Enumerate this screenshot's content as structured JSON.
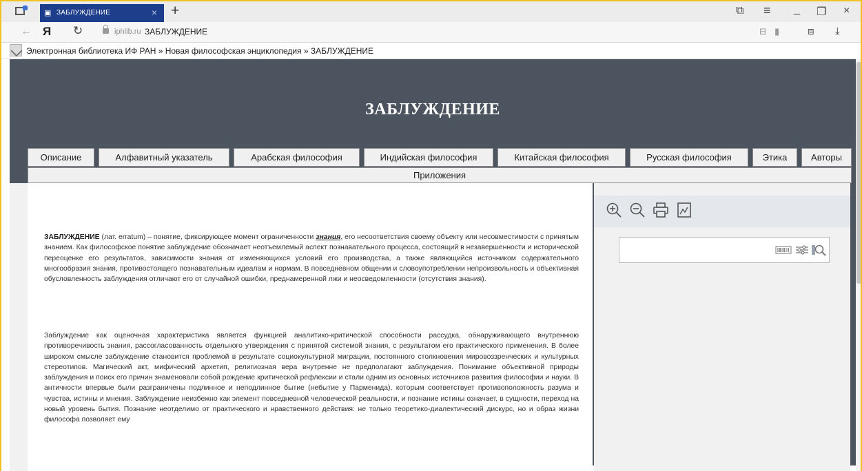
{
  "browser": {
    "tab_title": "ЗАБЛУЖДЕНИЕ",
    "tab_close": "×",
    "new_tab": "+",
    "host": "iphlib.ru",
    "page_title": "ЗАБЛУЖДЕНИЕ",
    "yandex_logo": "Я"
  },
  "breadcrumb": {
    "text": "Электронная библиотека ИФ РАН » Новая философская энциклопедия » ЗАБЛУЖДЕНИЕ"
  },
  "header": {
    "title": "ЗАБЛУЖДЕНИЕ"
  },
  "nav": {
    "items": [
      "Описание",
      "Алфавитный указатель",
      "Арабская философия",
      "Индийская философия",
      "Китайская философия",
      "Русская философия",
      "Этика",
      "Авторы"
    ],
    "row2": "Приложения"
  },
  "article": {
    "p1_term": "ЗАБЛУЖДЕНИЕ",
    "p1_part1": " (лат. erratum) – понятие, фиксирующее момент ограниченности ",
    "p1_link": "знания",
    "p1_part2": ", его несоответствия своему объекту или несовместимости с принятым знанием. Как философское понятие заблуждение обозначает неотъемлемый аспект познавательного процесса, состоящий в незавершенности и исторической переоценке его результатов, зависимости знания от изменяющихся условий его производства, а также являющийся источником содержательного многообразия знания, противостоящего познавательным идеалам и нормам. В повседневном общении и словоупотреблении непроизвольность и объективная обусловленность заблуждения отличают его от случайной ошибки, преднамеренной лжи и неосведомленности (отсутствия знания).",
    "p2": "Заблуждение как оценочная характеристика является функцией аналитико-критической способности рассудка, обнаруживающего внутреннюю противоречивость знания, рассогласованность отдельного утверждения с принятой системой знания, с результатом его практического применения. В более широком смысле заблуждение становится проблемой в результате социокультурной миграции, постоянного столкновения мировоззренческих и культурных стереотипов. Магический акт, мифический архетип, религиозная вера внутренне не предполагают заблуждения. Понимание объективной природы заблуждения и поиск его причин знаменовали собой рождение критической рефлексии и стали одним из основных источников развития философии и науки. В античности впервые были разграничены подлинное и неподлинное бытие (небытие у Парменида), которым соответствует противоположность разума и чувства, истины и мнения. Заблуждение неизбежно как элемент повседневной человеческой реальности, и познание истины означает, в сущности, переход на новый уровень бытия. Познание неотделимо от практического и нравственного действия: не только теоретико-диалектический дискурс, но и образ жизни философа позволяет ему"
  },
  "tools": {
    "icons": [
      "zoom-in-icon",
      "zoom-out-icon",
      "print-icon",
      "export-icon"
    ]
  },
  "search": {
    "value": ""
  }
}
